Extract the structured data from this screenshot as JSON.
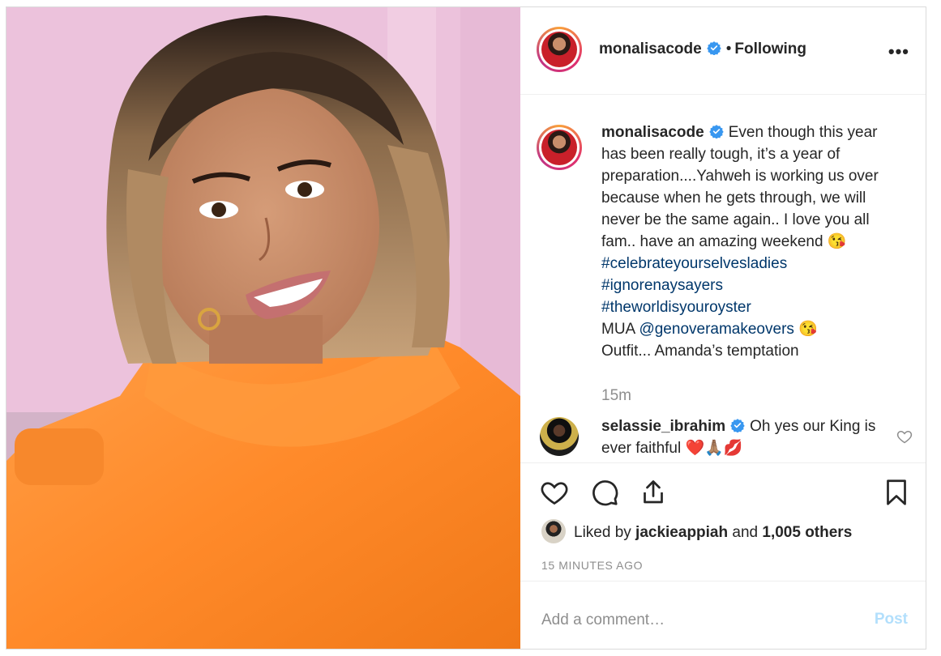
{
  "post": {
    "username": "monalisacode",
    "follow_status": "Following",
    "separator": "•",
    "more_label": "•••",
    "caption": {
      "lines": [
        "Even though this year",
        "has been really tough, it’s a year of",
        "preparation....Yahweh is working us over",
        "because when he gets through, we will",
        "never be the same again.. I love you all",
        "fam.. have an amazing weekend 😘"
      ],
      "hashtags": [
        "#celebrateyourselvesladies",
        "#ignorenaysayers",
        "#theworldisyouroyster"
      ],
      "mua_prefix": "MUA ",
      "mua_handle": "@genoveramakeovers",
      "mua_emoji": " 😘",
      "outfit": "Outfit... Amanda’s temptation"
    },
    "time_ago": "15m",
    "comments": [
      {
        "username": "selassie_ibrahim",
        "text": "Oh yes our King is ever faithful ❤️🙏🏽💋"
      }
    ],
    "likes": {
      "prefix": "Liked by ",
      "user": "jackieappiah",
      "middle": " and ",
      "others": "1,005 others"
    },
    "timestamp": "15 MINUTES AGO",
    "comment_placeholder": "Add a comment…",
    "post_label": "Post"
  },
  "icons": [
    "verified-badge-icon",
    "heart-icon",
    "comment-icon",
    "share-icon",
    "bookmark-icon",
    "more-icon"
  ],
  "colors": {
    "verified": "#3897f0",
    "link": "#00376b",
    "muted": "#8e8e8e",
    "post_button": "#b2dffc",
    "photo_scarf": "#ff8a2a"
  }
}
